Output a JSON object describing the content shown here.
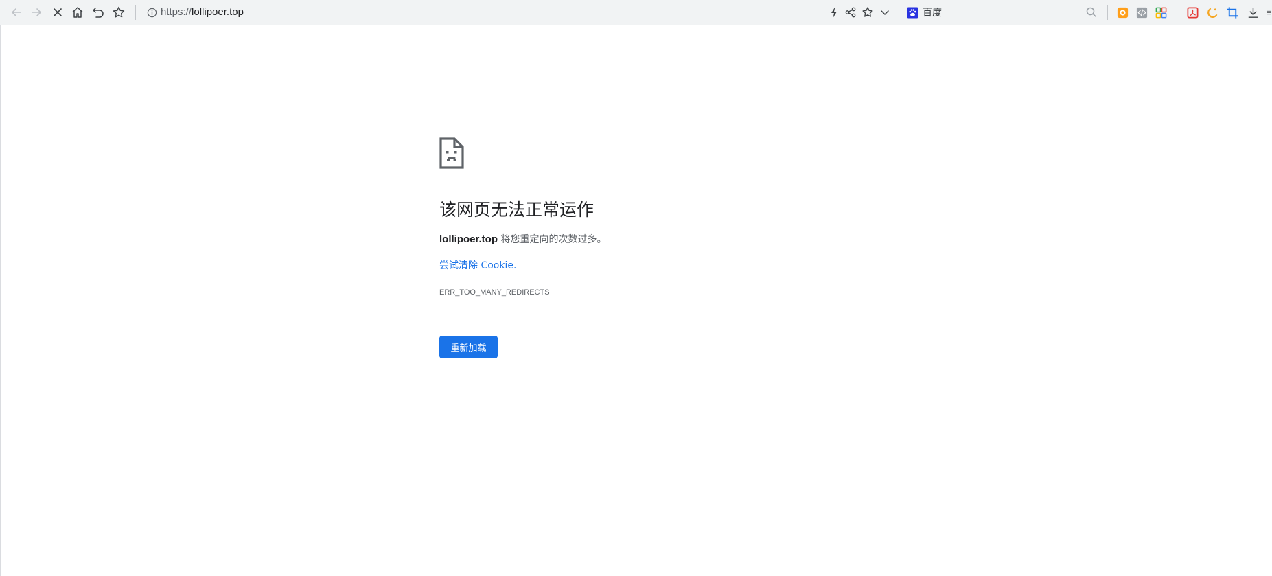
{
  "address_bar": {
    "url_scheme": "https://",
    "url_host": "lollipoer.top"
  },
  "search": {
    "engine_name": "百度"
  },
  "error_page": {
    "title": "该网页无法正常运作",
    "host": "lollipoer.top",
    "description_suffix": " 将您重定向的次数过多。",
    "suggestion_link": "尝试清除 Cookie.",
    "error_code": "ERR_TOO_MANY_REDIRECTS",
    "reload_button": "重新加载"
  },
  "colors": {
    "accent": "#1a73e8",
    "toolbar_bg": "#f1f3f4",
    "text": "#202124"
  },
  "icons": [
    "back-arrow-icon",
    "forward-arrow-icon",
    "stop-loading-icon",
    "home-icon",
    "undo-icon",
    "bookmark-star-icon",
    "site-info-icon",
    "lightning-icon",
    "share-icon",
    "star-icon",
    "chevron-down-icon",
    "baidu-paw-icon",
    "search-icon",
    "extension-orange-icon",
    "code-icon",
    "grid-apps-icon",
    "pdf-icon",
    "moon-icon",
    "crop-icon",
    "download-icon",
    "menu-icon"
  ]
}
